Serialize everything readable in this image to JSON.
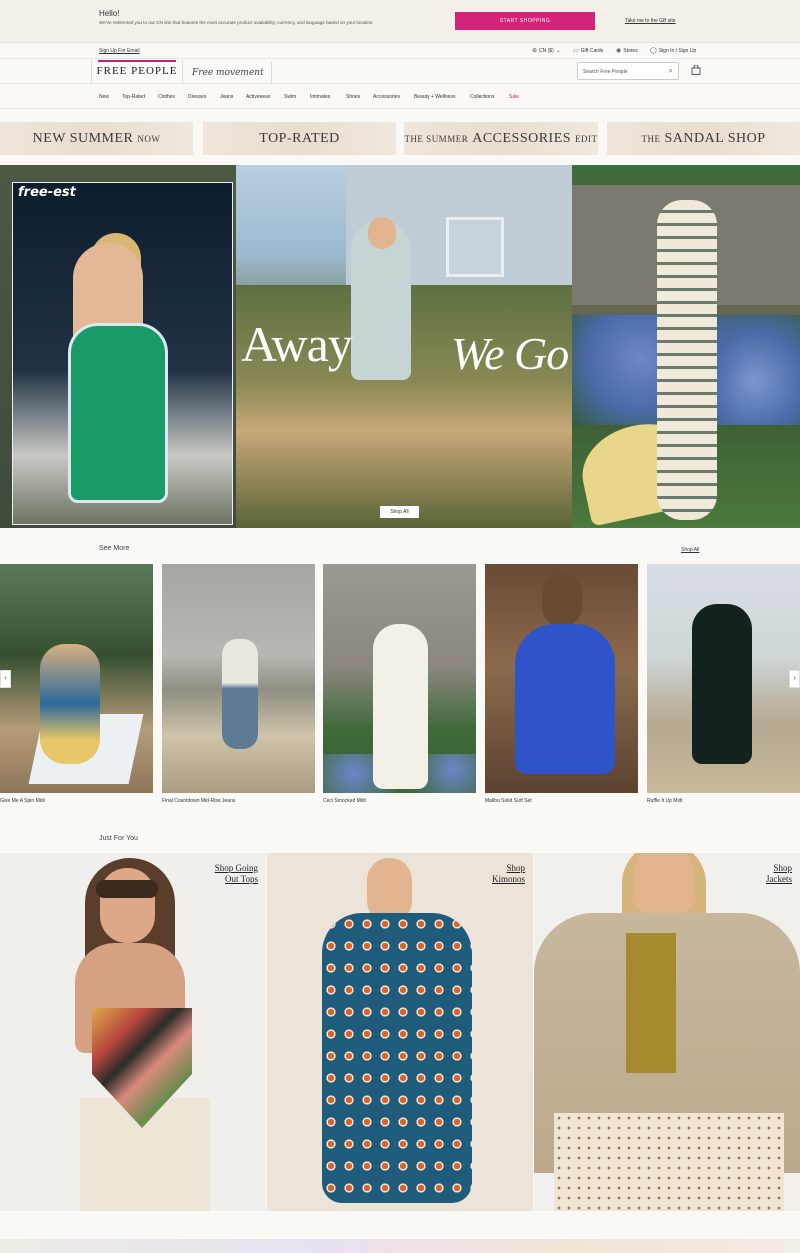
{
  "redirect": {
    "hello": "Hello!",
    "message": "We've redirected you to our CN site that features the most accurate product availability, currency, and language based on your location.",
    "start_button": "START SHOPPING",
    "gb_link": "Take me to the GB site"
  },
  "utility": {
    "signup_email": "Sign Up For Email",
    "currency": "CN ($)",
    "gift_cards": "Gift Cards",
    "stores": "Stores",
    "sign_in": "Sign In / Sign Up"
  },
  "header": {
    "logo_free_people": "FREE PEOPLE",
    "logo_movement": "Free movement",
    "search_placeholder": "Search Free People"
  },
  "nav": {
    "items": [
      "New",
      "Top-Rated",
      "Clothes",
      "Dresses",
      "Jeans",
      "Activewear",
      "Swim",
      "Intimates",
      "Shoes",
      "Accessories",
      "Beauty + Wellness",
      "Collections",
      "Sale"
    ]
  },
  "promos": [
    {
      "big": "NEW SUMMER",
      "small_after": "NOW"
    },
    {
      "big": "TOP-RATED"
    },
    {
      "small_before": "THE SUMMER",
      "big": "ACCESSORIES",
      "small_after": "EDIT"
    },
    {
      "small_before": "THE",
      "big": "SANDAL SHOP"
    }
  ],
  "hero": {
    "brand_tag": "free-est",
    "headline_left": "Away",
    "headline_right": "We Go",
    "cta": "Shop All"
  },
  "see_more": {
    "title": "See More",
    "shop_all": "Shop All",
    "products": [
      "Give Me A Spin Midi",
      "Final Countdown Mid-Rise Jeans",
      "Ceci Smocked Midi",
      "Malibu Solid Surf Set",
      "Ruffle It Up Midi"
    ],
    "prev_icon": "chevron-left-icon",
    "next_icon": "chevron-right-icon"
  },
  "just_for_you": {
    "title": "Just For You",
    "tiles": [
      {
        "line1": "Shop Going",
        "line2": "Out Tops"
      },
      {
        "line1": "Shop",
        "line2": "Kimonos"
      },
      {
        "line1": "Shop",
        "line2": "Jackets"
      }
    ]
  },
  "colors": {
    "accent": "#d4247a",
    "sale": "#c22670",
    "background": "#fbf9f6"
  }
}
